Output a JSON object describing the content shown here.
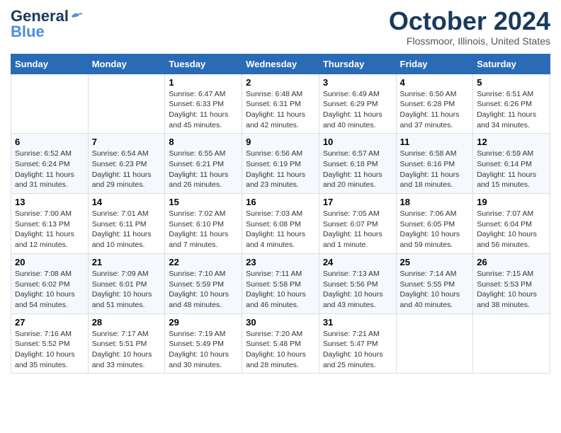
{
  "header": {
    "logo_line1": "General",
    "logo_line2": "Blue",
    "month": "October 2024",
    "location": "Flossmoor, Illinois, United States"
  },
  "weekdays": [
    "Sunday",
    "Monday",
    "Tuesday",
    "Wednesday",
    "Thursday",
    "Friday",
    "Saturday"
  ],
  "weeks": [
    [
      {
        "day": "",
        "content": ""
      },
      {
        "day": "",
        "content": ""
      },
      {
        "day": "1",
        "content": "Sunrise: 6:47 AM\nSunset: 6:33 PM\nDaylight: 11 hours and 45 minutes."
      },
      {
        "day": "2",
        "content": "Sunrise: 6:48 AM\nSunset: 6:31 PM\nDaylight: 11 hours and 42 minutes."
      },
      {
        "day": "3",
        "content": "Sunrise: 6:49 AM\nSunset: 6:29 PM\nDaylight: 11 hours and 40 minutes."
      },
      {
        "day": "4",
        "content": "Sunrise: 6:50 AM\nSunset: 6:28 PM\nDaylight: 11 hours and 37 minutes."
      },
      {
        "day": "5",
        "content": "Sunrise: 6:51 AM\nSunset: 6:26 PM\nDaylight: 11 hours and 34 minutes."
      }
    ],
    [
      {
        "day": "6",
        "content": "Sunrise: 6:52 AM\nSunset: 6:24 PM\nDaylight: 11 hours and 31 minutes."
      },
      {
        "day": "7",
        "content": "Sunrise: 6:54 AM\nSunset: 6:23 PM\nDaylight: 11 hours and 29 minutes."
      },
      {
        "day": "8",
        "content": "Sunrise: 6:55 AM\nSunset: 6:21 PM\nDaylight: 11 hours and 26 minutes."
      },
      {
        "day": "9",
        "content": "Sunrise: 6:56 AM\nSunset: 6:19 PM\nDaylight: 11 hours and 23 minutes."
      },
      {
        "day": "10",
        "content": "Sunrise: 6:57 AM\nSunset: 6:18 PM\nDaylight: 11 hours and 20 minutes."
      },
      {
        "day": "11",
        "content": "Sunrise: 6:58 AM\nSunset: 6:16 PM\nDaylight: 11 hours and 18 minutes."
      },
      {
        "day": "12",
        "content": "Sunrise: 6:59 AM\nSunset: 6:14 PM\nDaylight: 11 hours and 15 minutes."
      }
    ],
    [
      {
        "day": "13",
        "content": "Sunrise: 7:00 AM\nSunset: 6:13 PM\nDaylight: 11 hours and 12 minutes."
      },
      {
        "day": "14",
        "content": "Sunrise: 7:01 AM\nSunset: 6:11 PM\nDaylight: 11 hours and 10 minutes."
      },
      {
        "day": "15",
        "content": "Sunrise: 7:02 AM\nSunset: 6:10 PM\nDaylight: 11 hours and 7 minutes."
      },
      {
        "day": "16",
        "content": "Sunrise: 7:03 AM\nSunset: 6:08 PM\nDaylight: 11 hours and 4 minutes."
      },
      {
        "day": "17",
        "content": "Sunrise: 7:05 AM\nSunset: 6:07 PM\nDaylight: 11 hours and 1 minute."
      },
      {
        "day": "18",
        "content": "Sunrise: 7:06 AM\nSunset: 6:05 PM\nDaylight: 10 hours and 59 minutes."
      },
      {
        "day": "19",
        "content": "Sunrise: 7:07 AM\nSunset: 6:04 PM\nDaylight: 10 hours and 56 minutes."
      }
    ],
    [
      {
        "day": "20",
        "content": "Sunrise: 7:08 AM\nSunset: 6:02 PM\nDaylight: 10 hours and 54 minutes."
      },
      {
        "day": "21",
        "content": "Sunrise: 7:09 AM\nSunset: 6:01 PM\nDaylight: 10 hours and 51 minutes."
      },
      {
        "day": "22",
        "content": "Sunrise: 7:10 AM\nSunset: 5:59 PM\nDaylight: 10 hours and 48 minutes."
      },
      {
        "day": "23",
        "content": "Sunrise: 7:11 AM\nSunset: 5:58 PM\nDaylight: 10 hours and 46 minutes."
      },
      {
        "day": "24",
        "content": "Sunrise: 7:13 AM\nSunset: 5:56 PM\nDaylight: 10 hours and 43 minutes."
      },
      {
        "day": "25",
        "content": "Sunrise: 7:14 AM\nSunset: 5:55 PM\nDaylight: 10 hours and 40 minutes."
      },
      {
        "day": "26",
        "content": "Sunrise: 7:15 AM\nSunset: 5:53 PM\nDaylight: 10 hours and 38 minutes."
      }
    ],
    [
      {
        "day": "27",
        "content": "Sunrise: 7:16 AM\nSunset: 5:52 PM\nDaylight: 10 hours and 35 minutes."
      },
      {
        "day": "28",
        "content": "Sunrise: 7:17 AM\nSunset: 5:51 PM\nDaylight: 10 hours and 33 minutes."
      },
      {
        "day": "29",
        "content": "Sunrise: 7:19 AM\nSunset: 5:49 PM\nDaylight: 10 hours and 30 minutes."
      },
      {
        "day": "30",
        "content": "Sunrise: 7:20 AM\nSunset: 5:48 PM\nDaylight: 10 hours and 28 minutes."
      },
      {
        "day": "31",
        "content": "Sunrise: 7:21 AM\nSunset: 5:47 PM\nDaylight: 10 hours and 25 minutes."
      },
      {
        "day": "",
        "content": ""
      },
      {
        "day": "",
        "content": ""
      }
    ]
  ]
}
